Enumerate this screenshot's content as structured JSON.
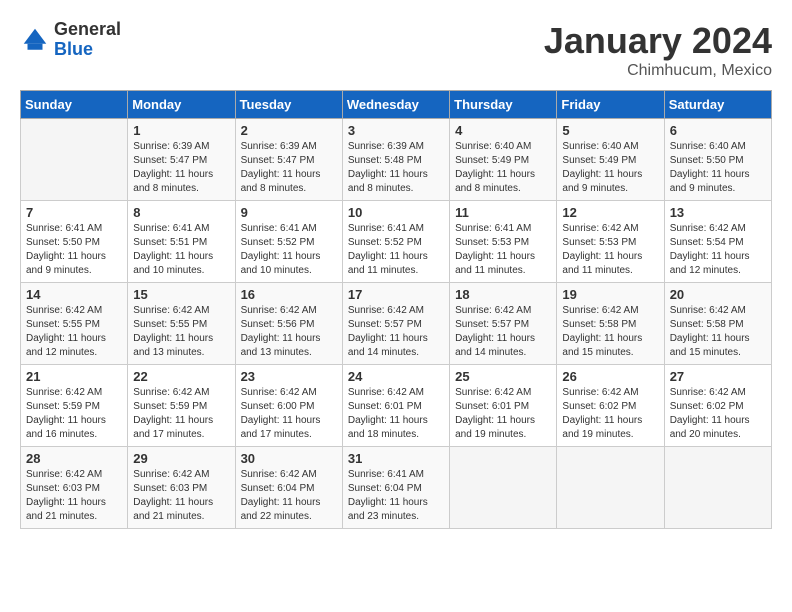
{
  "header": {
    "logo_general": "General",
    "logo_blue": "Blue",
    "month_title": "January 2024",
    "location": "Chimhucum, Mexico"
  },
  "days_of_week": [
    "Sunday",
    "Monday",
    "Tuesday",
    "Wednesday",
    "Thursday",
    "Friday",
    "Saturday"
  ],
  "weeks": [
    [
      {
        "day": "",
        "info": ""
      },
      {
        "day": "1",
        "info": "Sunrise: 6:39 AM\nSunset: 5:47 PM\nDaylight: 11 hours and 8 minutes."
      },
      {
        "day": "2",
        "info": "Sunrise: 6:39 AM\nSunset: 5:47 PM\nDaylight: 11 hours and 8 minutes."
      },
      {
        "day": "3",
        "info": "Sunrise: 6:39 AM\nSunset: 5:48 PM\nDaylight: 11 hours and 8 minutes."
      },
      {
        "day": "4",
        "info": "Sunrise: 6:40 AM\nSunset: 5:49 PM\nDaylight: 11 hours and 8 minutes."
      },
      {
        "day": "5",
        "info": "Sunrise: 6:40 AM\nSunset: 5:49 PM\nDaylight: 11 hours and 9 minutes."
      },
      {
        "day": "6",
        "info": "Sunrise: 6:40 AM\nSunset: 5:50 PM\nDaylight: 11 hours and 9 minutes."
      }
    ],
    [
      {
        "day": "7",
        "info": "Sunrise: 6:41 AM\nSunset: 5:50 PM\nDaylight: 11 hours and 9 minutes."
      },
      {
        "day": "8",
        "info": "Sunrise: 6:41 AM\nSunset: 5:51 PM\nDaylight: 11 hours and 10 minutes."
      },
      {
        "day": "9",
        "info": "Sunrise: 6:41 AM\nSunset: 5:52 PM\nDaylight: 11 hours and 10 minutes."
      },
      {
        "day": "10",
        "info": "Sunrise: 6:41 AM\nSunset: 5:52 PM\nDaylight: 11 hours and 11 minutes."
      },
      {
        "day": "11",
        "info": "Sunrise: 6:41 AM\nSunset: 5:53 PM\nDaylight: 11 hours and 11 minutes."
      },
      {
        "day": "12",
        "info": "Sunrise: 6:42 AM\nSunset: 5:53 PM\nDaylight: 11 hours and 11 minutes."
      },
      {
        "day": "13",
        "info": "Sunrise: 6:42 AM\nSunset: 5:54 PM\nDaylight: 11 hours and 12 minutes."
      }
    ],
    [
      {
        "day": "14",
        "info": "Sunrise: 6:42 AM\nSunset: 5:55 PM\nDaylight: 11 hours and 12 minutes."
      },
      {
        "day": "15",
        "info": "Sunrise: 6:42 AM\nSunset: 5:55 PM\nDaylight: 11 hours and 13 minutes."
      },
      {
        "day": "16",
        "info": "Sunrise: 6:42 AM\nSunset: 5:56 PM\nDaylight: 11 hours and 13 minutes."
      },
      {
        "day": "17",
        "info": "Sunrise: 6:42 AM\nSunset: 5:57 PM\nDaylight: 11 hours and 14 minutes."
      },
      {
        "day": "18",
        "info": "Sunrise: 6:42 AM\nSunset: 5:57 PM\nDaylight: 11 hours and 14 minutes."
      },
      {
        "day": "19",
        "info": "Sunrise: 6:42 AM\nSunset: 5:58 PM\nDaylight: 11 hours and 15 minutes."
      },
      {
        "day": "20",
        "info": "Sunrise: 6:42 AM\nSunset: 5:58 PM\nDaylight: 11 hours and 15 minutes."
      }
    ],
    [
      {
        "day": "21",
        "info": "Sunrise: 6:42 AM\nSunset: 5:59 PM\nDaylight: 11 hours and 16 minutes."
      },
      {
        "day": "22",
        "info": "Sunrise: 6:42 AM\nSunset: 5:59 PM\nDaylight: 11 hours and 17 minutes."
      },
      {
        "day": "23",
        "info": "Sunrise: 6:42 AM\nSunset: 6:00 PM\nDaylight: 11 hours and 17 minutes."
      },
      {
        "day": "24",
        "info": "Sunrise: 6:42 AM\nSunset: 6:01 PM\nDaylight: 11 hours and 18 minutes."
      },
      {
        "day": "25",
        "info": "Sunrise: 6:42 AM\nSunset: 6:01 PM\nDaylight: 11 hours and 19 minutes."
      },
      {
        "day": "26",
        "info": "Sunrise: 6:42 AM\nSunset: 6:02 PM\nDaylight: 11 hours and 19 minutes."
      },
      {
        "day": "27",
        "info": "Sunrise: 6:42 AM\nSunset: 6:02 PM\nDaylight: 11 hours and 20 minutes."
      }
    ],
    [
      {
        "day": "28",
        "info": "Sunrise: 6:42 AM\nSunset: 6:03 PM\nDaylight: 11 hours and 21 minutes."
      },
      {
        "day": "29",
        "info": "Sunrise: 6:42 AM\nSunset: 6:03 PM\nDaylight: 11 hours and 21 minutes."
      },
      {
        "day": "30",
        "info": "Sunrise: 6:42 AM\nSunset: 6:04 PM\nDaylight: 11 hours and 22 minutes."
      },
      {
        "day": "31",
        "info": "Sunrise: 6:41 AM\nSunset: 6:04 PM\nDaylight: 11 hours and 23 minutes."
      },
      {
        "day": "",
        "info": ""
      },
      {
        "day": "",
        "info": ""
      },
      {
        "day": "",
        "info": ""
      }
    ]
  ]
}
